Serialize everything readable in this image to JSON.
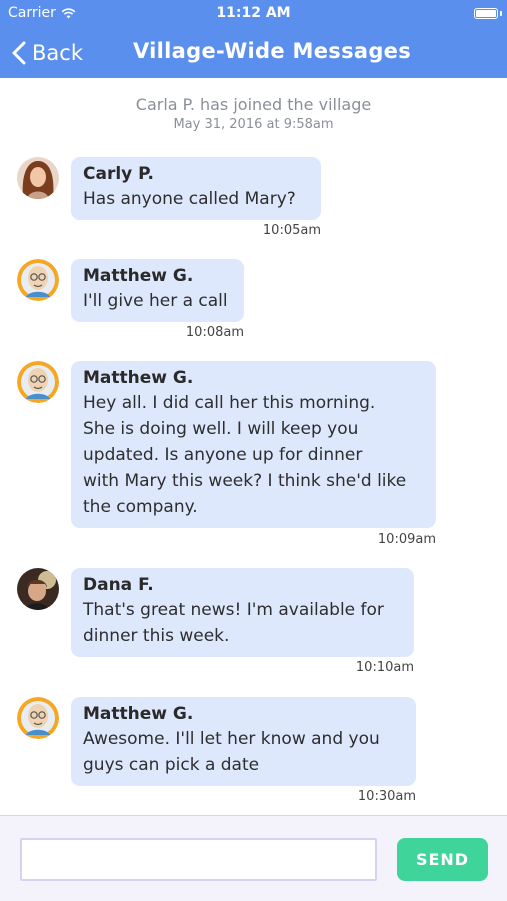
{
  "status_bar": {
    "carrier": "Carrier",
    "time": "11:12 AM"
  },
  "nav": {
    "back_label": "Back",
    "title": "Village-Wide Messages"
  },
  "system_message": {
    "text": "Carla P. has joined the village",
    "date": "May 31, 2016 at 9:58am"
  },
  "messages": [
    {
      "sender": "Carly P.",
      "lines": [
        "Has anyone called Mary?"
      ],
      "time": "10:05am",
      "avatar": "photo-avatar"
    },
    {
      "sender": "Matthew G.",
      "lines": [
        "I'll give her a call"
      ],
      "time": "10:08am",
      "avatar": "cartoon-avatar"
    },
    {
      "sender": "Matthew G.",
      "lines": [
        "Hey all. I did call her this morning.",
        "She is doing well. I will keep you",
        "updated. Is anyone up for dinner",
        "with Mary this week? I think she'd like",
        "the company."
      ],
      "time": "10:09am",
      "avatar": "cartoon-avatar"
    },
    {
      "sender": "Dana F.",
      "lines": [
        "That's great news! I'm available for",
        "dinner this week."
      ],
      "time": "10:10am",
      "avatar": "photo-avatar"
    },
    {
      "sender": "Matthew G.",
      "lines": [
        "Awesome. I'll let her know and you",
        "guys can pick a date"
      ],
      "time": "10:30am",
      "avatar": "cartoon-avatar"
    }
  ],
  "input": {
    "value": "",
    "send_label": "SEND"
  },
  "colors": {
    "header": "#5b8fee",
    "bubble": "#dde8fd",
    "send_button": "#3fd49a",
    "avatar_ring": "#f5a623"
  }
}
